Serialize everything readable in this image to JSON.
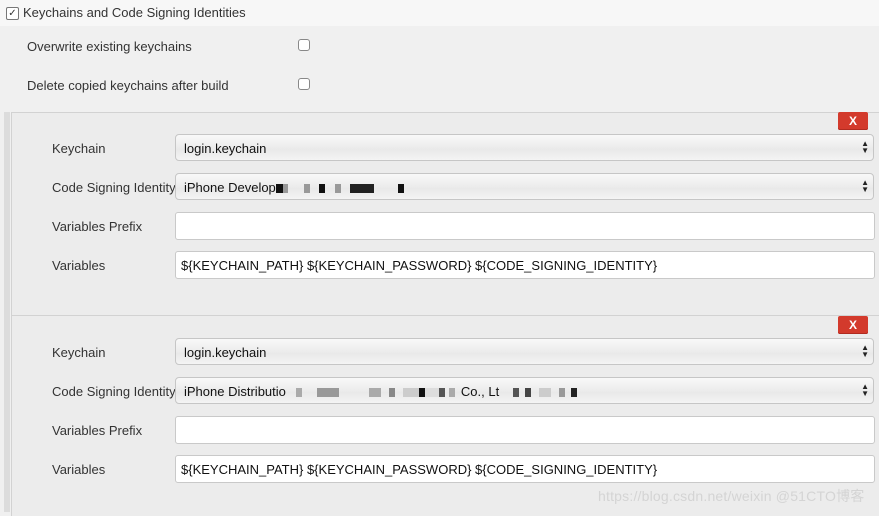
{
  "section": {
    "title": "Keychains and Code Signing Identities",
    "enabled": true
  },
  "options": [
    {
      "label": "Overwrite existing keychains",
      "checked": false
    },
    {
      "label": "Delete copied keychains after build",
      "checked": false
    }
  ],
  "labels": {
    "keychain": "Keychain",
    "identity": "Code Signing Identity",
    "prefix": "Variables Prefix",
    "variables": "Variables",
    "delete": "X"
  },
  "entries": [
    {
      "keychain": "login.keychain",
      "identity": "iPhone Develop",
      "variables_prefix": "",
      "variables": "${KEYCHAIN_PATH} ${KEYCHAIN_PASSWORD} ${CODE_SIGNING_IDENTITY}"
    },
    {
      "keychain": "login.keychain",
      "identity": "iPhone Distributio",
      "identity_suffix": "Co., Lt",
      "variables_prefix": "",
      "variables": "${KEYCHAIN_PATH} ${KEYCHAIN_PASSWORD} ${CODE_SIGNING_IDENTITY}"
    }
  ],
  "watermark": "https://blog.csdn.net/weixin @51CTO博客"
}
